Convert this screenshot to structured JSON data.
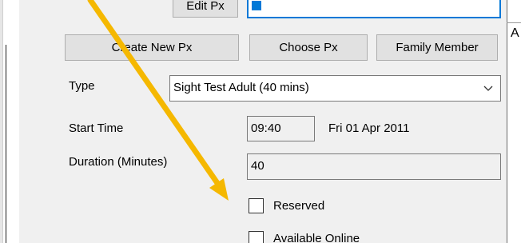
{
  "buttons": {
    "edit_px": "Edit Px",
    "create_new_px": "Create New Px",
    "choose_px": "Choose Px",
    "family_member": "Family Member"
  },
  "form": {
    "type_label": "Type",
    "type_value": "Sight Test Adult (40 mins)",
    "start_time_label": "Start Time",
    "start_time_value": "09:40",
    "start_date_value": "Fri 01 Apr 2011",
    "duration_label": "Duration (Minutes)",
    "duration_value": "40",
    "reserved_label": "Reserved",
    "reserved_checked": false,
    "available_online_label": "Available Online",
    "available_online_checked": false
  },
  "background_window": {
    "partial_text": "A"
  },
  "colors": {
    "dialog_bg": "#f0f0f0",
    "focus_border": "#0078d7",
    "annotation_arrow": "#f5b800"
  },
  "icons": {
    "combo_dropdown": "chevron-down-icon",
    "annotation": "annotation-arrow"
  }
}
